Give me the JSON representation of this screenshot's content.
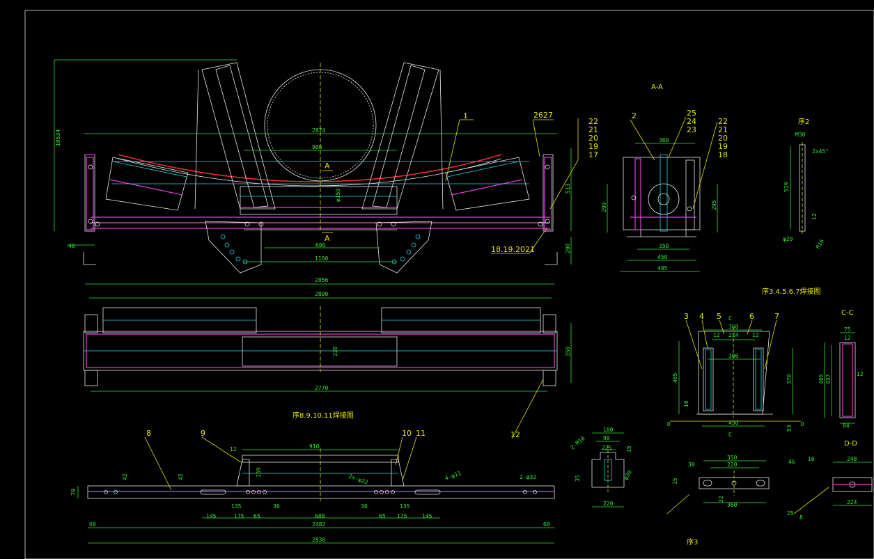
{
  "drawing": {
    "views": {
      "aa": "A-A",
      "cc": "C-C",
      "dd": "D-D"
    },
    "titles": {
      "part2": "序2",
      "parts34567": "序3.4.5.6.7焊接图",
      "parts891011": "序8.9.10.11焊接图",
      "part3": "序3"
    },
    "balloons": {
      "b1": "1",
      "b2627": "2627",
      "b2": "2",
      "b25": "25",
      "b24": "24",
      "b23": "23",
      "b22a": "22",
      "b21a": "21",
      "b20a": "20",
      "b19a": "19",
      "b17": "17",
      "b22b": "22",
      "b21b": "21",
      "b20b": "20",
      "b19b": "19",
      "b18": "18",
      "b181920": "18.19.2021",
      "b12": "12",
      "b3": "3",
      "b4": "4",
      "b5": "5",
      "b6": "6",
      "b7": "7",
      "b8": "8",
      "b9": "9",
      "b10": "10",
      "b11": "11",
      "secA1": "A",
      "secA2": "A",
      "secC1": "C",
      "secC2": "C",
      "secD1": "D",
      "secD2": "D"
    },
    "dims": {
      "d10534": "10534",
      "d2874": "2874",
      "d900": "900",
      "d159a": "φ159",
      "d600": "600",
      "d1160": "1160",
      "d40": "40",
      "d513a": "513",
      "d200": "200",
      "d360a": "360",
      "d299": "299",
      "d295": "295",
      "d350a": "350",
      "d450a": "450",
      "d495": "495",
      "dM30": "M30",
      "d2x45": "2x45°",
      "d519": "519",
      "d12a": "12",
      "dphi20": "φ20",
      "dR16": "R16",
      "d2856": "2856",
      "d2800": "2800",
      "d220": "220",
      "d350b": "350",
      "d2770": "2770",
      "d360b": "360",
      "d224": "224",
      "d12b": "12",
      "d12c": "12",
      "d306": "306",
      "d465a": "465",
      "d370": "370",
      "d16a": "16",
      "d450b": "450",
      "d53": "53",
      "d75": "75",
      "d12d": "12",
      "d465b": "465",
      "d437": "437",
      "d12e": "12",
      "d84": "84",
      "d910": "910",
      "d12f": "12",
      "d159b": "159",
      "d42a": "42",
      "d42b": "42",
      "d79": "79",
      "d2x32": "2-φ32",
      "d2x22": "2x-φ22",
      "d4x11": "4-φ11",
      "d135a": "135",
      "d30a": "30",
      "d30b": "30",
      "d135b": "135",
      "d60a": "60",
      "d145a": "145",
      "d175a": "175",
      "d65a": "65",
      "d688": "688",
      "d65b": "65",
      "d175b": "175",
      "d145b": "145",
      "d60b": "60",
      "d2482": "2482",
      "d2830": "2830",
      "d180": "180",
      "d90": "90",
      "d225": "225",
      "d15": "15",
      "d2xM10": "2-M10",
      "d35": "35",
      "d220b": "220",
      "dphi30": "φ30",
      "d350c": "350",
      "d30c": "30",
      "d220c": "220",
      "d15b": "15",
      "d360c": "360",
      "d32": "32",
      "d46": "46",
      "d248": "248",
      "d224b": "224",
      "d8": "8",
      "d25": "25",
      "d16b": "16"
    }
  }
}
